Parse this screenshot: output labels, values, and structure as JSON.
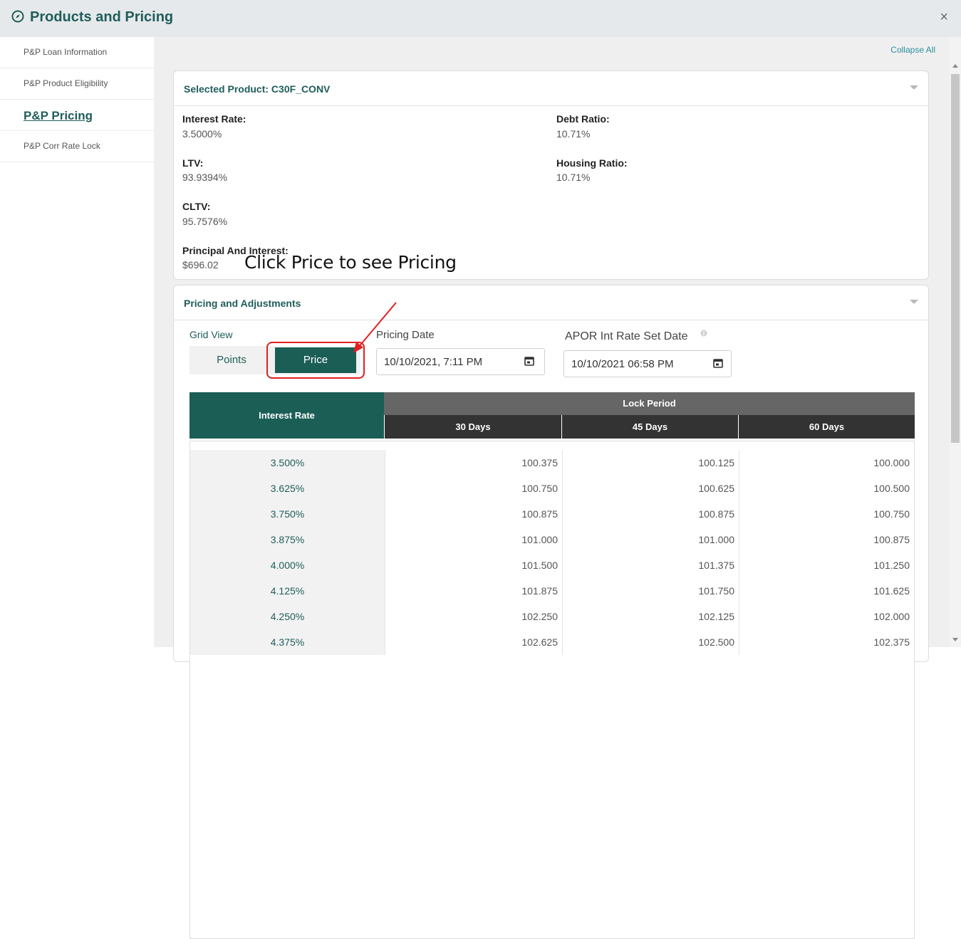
{
  "window": {
    "title": "Products and Pricing",
    "close_label": "×"
  },
  "sidebar": {
    "items": [
      {
        "label": "P&P Loan Information"
      },
      {
        "label": "P&P Product Eligibility"
      },
      {
        "label": "P&P Pricing",
        "active": true
      },
      {
        "label": "P&P Corr Rate Lock"
      }
    ]
  },
  "main": {
    "collapse_all": "Collapse All"
  },
  "product_panel": {
    "title": "Selected Product: C30F_CONV",
    "fields": {
      "interest_rate": {
        "label": "Interest Rate:",
        "value": "3.5000%"
      },
      "debt_ratio": {
        "label": "Debt Ratio:",
        "value": "10.71%"
      },
      "ltv": {
        "label": "LTV:",
        "value": "93.9394%"
      },
      "housing_ratio": {
        "label": "Housing Ratio:",
        "value": "10.71%"
      },
      "cltv": {
        "label": "CLTV:",
        "value": "95.7576%"
      },
      "principal_interest": {
        "label": "Principal And Interest:",
        "value": "$696.02"
      }
    }
  },
  "pricing_panel": {
    "title": "Pricing and Adjustments",
    "annotation": "Click Price to see Pricing",
    "grid_view_label": "Grid View",
    "points_label": "Points",
    "price_label": "Price",
    "pricing_date_label": "Pricing Date",
    "pricing_date_value": "10/10/2021, 7:11 PM",
    "apor_label": "APOR Int Rate Set Date",
    "apor_value": "10/10/2021 06:58 PM",
    "table": {
      "interest_rate_header": "Interest Rate",
      "lock_period_header": "Lock Period",
      "day_headers": [
        "30 Days",
        "45 Days",
        "60 Days"
      ],
      "rows": [
        {
          "rate": "3.500%",
          "d30": "100.375",
          "d45": "100.125",
          "d60": "100.000"
        },
        {
          "rate": "3.625%",
          "d30": "100.750",
          "d45": "100.625",
          "d60": "100.500"
        },
        {
          "rate": "3.750%",
          "d30": "100.875",
          "d45": "100.875",
          "d60": "100.750"
        },
        {
          "rate": "3.875%",
          "d30": "101.000",
          "d45": "101.000",
          "d60": "100.875"
        },
        {
          "rate": "4.000%",
          "d30": "101.500",
          "d45": "101.375",
          "d60": "101.250"
        },
        {
          "rate": "4.125%",
          "d30": "101.875",
          "d45": "101.750",
          "d60": "101.625"
        },
        {
          "rate": "4.250%",
          "d30": "102.250",
          "d45": "102.125",
          "d60": "102.000"
        },
        {
          "rate": "4.375%",
          "d30": "102.625",
          "d45": "102.500",
          "d60": "102.375"
        }
      ]
    }
  },
  "colors": {
    "brand_green": "#1a5e55",
    "title_green": "#1f5d5a",
    "highlight_red": "#e02020"
  }
}
